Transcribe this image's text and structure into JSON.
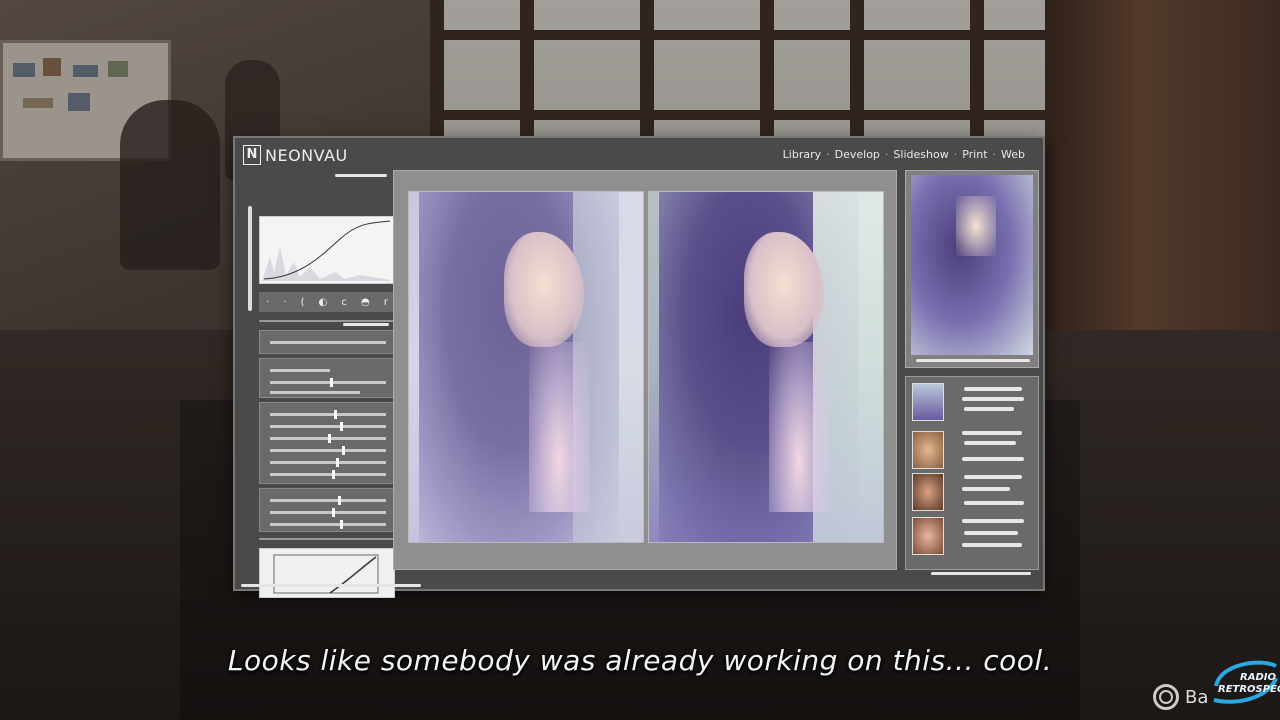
{
  "app": {
    "logo_mark": "N",
    "logo_text": "NEONVAU",
    "nav": [
      "Library",
      "Develop",
      "Slideshow",
      "Print",
      "Web"
    ],
    "nav_separator": "·",
    "tool_icons": [
      "·",
      "·",
      "(",
      "◐",
      "c",
      "◓",
      "r"
    ]
  },
  "subtitle": "Looks like somebody was already working on this...  cool.",
  "prompt": {
    "button_icon": "circle-button-icon",
    "label": "Ba"
  },
  "watermark": {
    "line1": "RADIO",
    "line2": "RETROSPECT"
  },
  "colors": {
    "panel": "#4a4a4a",
    "accent_purple": "#5a4f8a",
    "subtitle_text": "#f4f4f4",
    "watermark_blue": "#2aa8e0"
  }
}
